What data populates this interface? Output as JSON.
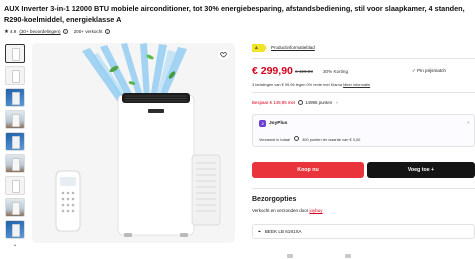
{
  "product": {
    "title": "AUX Inverter 3-in-1 12000 BTU mobiele airconditioner, tot 30% energiebesparing, afstandsbediening, stil voor slaapkamer, 4 standen, R290-koelmiddel, energieklasse A",
    "rating": "4.9",
    "reviews": "(30+ beoordelingen)",
    "sold": "200+ verkocht"
  },
  "gallery": {
    "thumb_count": 9,
    "arrow": "⌄"
  },
  "badges": {
    "energy_label": "A",
    "product_info": "Productinformatieblad"
  },
  "pricing": {
    "price": "€ 299,90",
    "old_price": "€ 429,90",
    "discount": "30% Korting",
    "pin": "Pin prijsmatch",
    "klarna_prefix": "3 betalingen van € 99,96 tegen 0% rente met Klarna ",
    "klarna_link": "Meer informatie"
  },
  "savings": {
    "red_text": "Bespaar € 149,95 met",
    "points": "14995 punten"
  },
  "joyplus": {
    "name": "JoyPlus",
    "line_prefix": "Verzamel in totaal",
    "line_points": "300 punten ter waarde van € 3,00"
  },
  "actions": {
    "buy": "Koop nu",
    "add": "Voeg toe +"
  },
  "shipping": {
    "title": "Bezorgopties",
    "line_prefix": "Verkocht en verzonden door ",
    "seller": "joybuy",
    "location": "BEEK LB 6191XA"
  },
  "icons": {
    "star": "★",
    "info": "i",
    "heart": "heart-icon",
    "check": "✓",
    "chevron": "›",
    "pin": "⌖"
  },
  "colors": {
    "accent_red": "#e8343a",
    "price_red": "#d6001c",
    "dark_button": "#141414",
    "energy_yellow": "#f3e42a",
    "joy_purple": "#6b3fd1"
  }
}
